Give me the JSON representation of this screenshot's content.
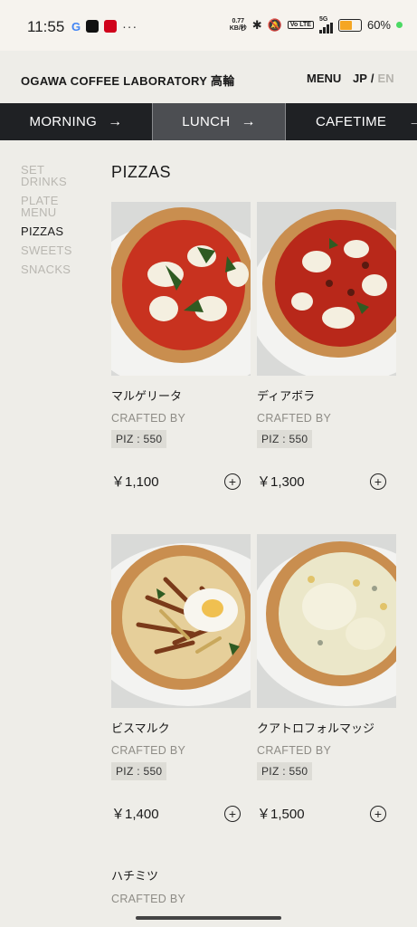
{
  "status_bar": {
    "time": "11:55",
    "net_speed": "0.77",
    "net_unit": "KB/秒",
    "network": "5G",
    "volte": "Vo LTE",
    "battery_percent": "60%",
    "battery_level": 0.6,
    "left_icons": [
      "google-icon",
      "app-icon",
      "app-icon",
      "more-icon"
    ]
  },
  "header": {
    "brand": "OGAWA COFFEE LABORATORY 高輪",
    "menu_label": "MENU",
    "lang_jp": "JP",
    "lang_separator": "/",
    "lang_en": "EN"
  },
  "tabs": [
    {
      "label": "MORNING",
      "icon": "arrow-right-icon"
    },
    {
      "label": "LUNCH",
      "icon": "arrow-right-icon",
      "active": true
    },
    {
      "label": "CAFETIME",
      "icon": "arrow-right-icon"
    }
  ],
  "sidenav": {
    "items": [
      {
        "label": "SET DRINKS"
      },
      {
        "label": "PLATE MENU"
      },
      {
        "label": "PIZZAS",
        "active": true
      },
      {
        "label": "SWEETS"
      },
      {
        "label": "SNACKS"
      }
    ]
  },
  "section": {
    "title": "PIZZAS"
  },
  "products": [
    {
      "name": "マルゲリータ",
      "crafted_by": "CRAFTED BY",
      "code": "PIZ : 550",
      "price": "￥1,100",
      "add_icon": "plus-circle-icon"
    },
    {
      "name": "ディアボラ",
      "crafted_by": "CRAFTED BY",
      "code": "PIZ : 550",
      "price": "￥1,300",
      "add_icon": "plus-circle-icon"
    },
    {
      "name": "ビスマルク",
      "crafted_by": "CRAFTED BY",
      "code": "PIZ : 550",
      "price": "￥1,400",
      "add_icon": "plus-circle-icon"
    },
    {
      "name": "クアトロフォルマッジ",
      "crafted_by": "CRAFTED BY",
      "code": "PIZ : 550",
      "price": "￥1,500",
      "add_icon": "plus-circle-icon"
    }
  ],
  "next_product": {
    "name": "ハチミツ",
    "crafted_by": "CRAFTED BY"
  },
  "colors": {
    "background": "#eeede8",
    "tab_bar": "#1f2124",
    "tab_active": "#4c4e52",
    "inactive_text": "#b9b7b1"
  }
}
